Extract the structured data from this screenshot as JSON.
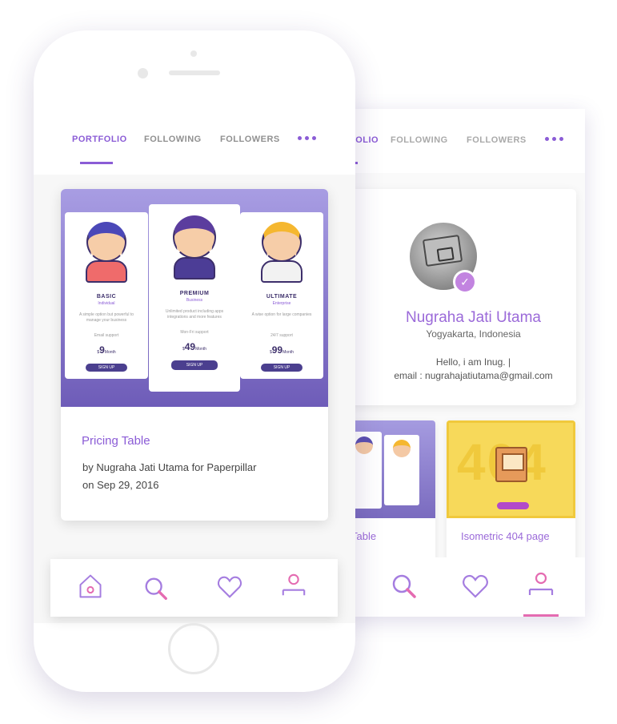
{
  "tabs": {
    "portfolio": "PORTFOLIO",
    "following": "FOLLOWING",
    "followers": "FOLLOWERS"
  },
  "back_tabs": {
    "portfolio_partial": "FOLIO",
    "following": "FOLLOWING",
    "followers": "FOLLOWERS"
  },
  "pricing_card": {
    "title": "Pricing Table",
    "by_line": "by Nugraha Jati Utama for Paperpillar",
    "date_line": "on Sep 29, 2016",
    "plans": [
      {
        "name": "BASIC",
        "subtitle": "Individual",
        "desc": "A simple option but powerful to manage your business",
        "support": "Email support",
        "price": "9",
        "period": "Month",
        "button": "SIGN UP"
      },
      {
        "name": "PREMIUM",
        "subtitle": "Business",
        "desc": "Unlimited product including apps integrations and more features",
        "support": "Mon-Fri support",
        "price": "49",
        "period": "Month",
        "button": "SIGN UP"
      },
      {
        "name": "ULTIMATE",
        "subtitle": "Enterprise",
        "desc": "A wise option for large companies",
        "support": "24/7 support",
        "price": "99",
        "period": "Month",
        "button": "SIGN UP"
      }
    ]
  },
  "profile": {
    "name": "Nugraha Jati Utama",
    "location": "Yogyakarta, Indonesia",
    "bio": "Hello, i am Inug. |",
    "email": "email : nugrahajatiutama@gmail.com",
    "verified_glyph": "✓"
  },
  "back_cards": {
    "pricing_partial_title": "Table",
    "err404_title": "Isometric 404 page",
    "err404_bg_text": "404"
  },
  "icons": {
    "nav": [
      "home-icon",
      "search-icon",
      "heart-icon",
      "profile-icon"
    ],
    "more": "more-dots-icon"
  },
  "colors": {
    "accent": "#8b5cd6",
    "nav_pink": "#e46bb1",
    "card_purple": "#7a6bbf",
    "yellow": "#f7d95a"
  }
}
